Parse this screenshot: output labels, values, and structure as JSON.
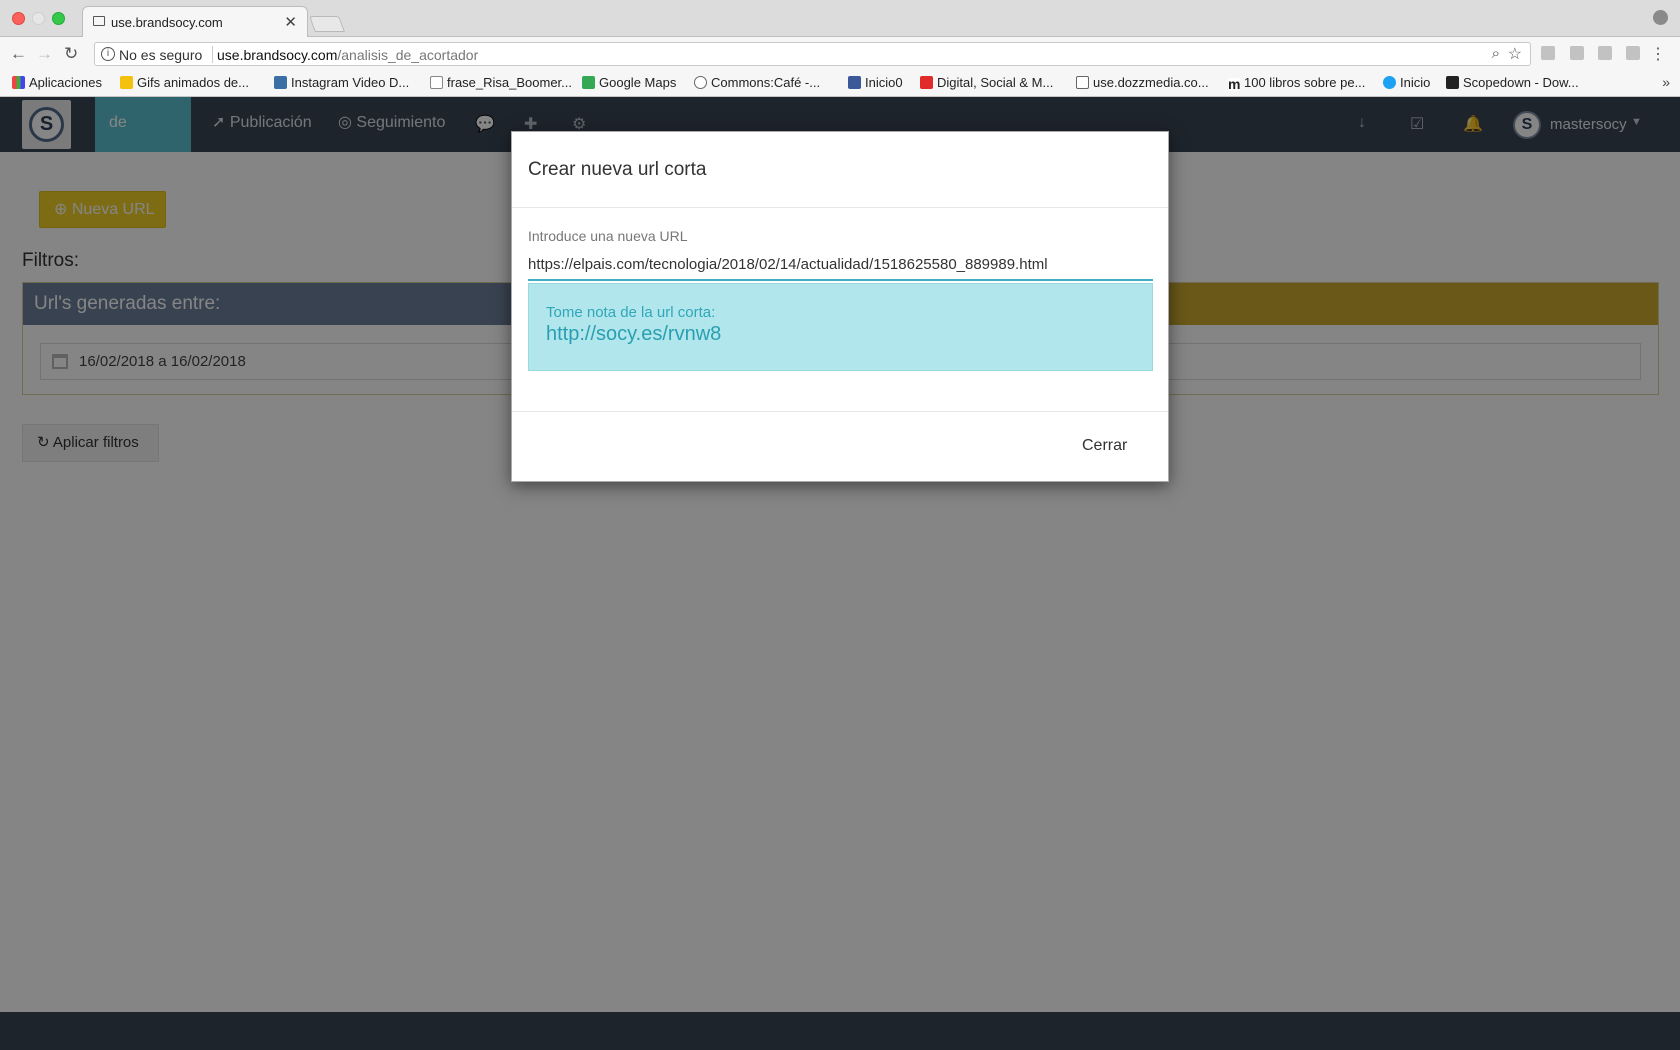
{
  "browser": {
    "tab_title": "use.brandsocy.com",
    "security_label": "No es seguro",
    "url_host": "use.brandsocy.com",
    "url_path": "/analisis_de_acortador",
    "bookmarks": [
      "Aplicaciones",
      "Gifs animados de...",
      "Instagram Video D...",
      "frase_Risa_Boomer...",
      "Google Maps",
      "Commons:Café -...",
      "Inicio0",
      "Digital, Social & M...",
      "use.dozzmedia.co...",
      "100 libros sobre pe...",
      "Inicio",
      "Scopedown - Dow..."
    ]
  },
  "app": {
    "nav": {
      "active_item": "de Tráfico",
      "items": [
        "Publicación",
        "Seguimiento"
      ],
      "user_name": "mastersocy"
    },
    "new_url_button": "Nueva URL",
    "filters_title": "Filtros:",
    "panel_title": "Url's generadas entre:",
    "date_range": "16/02/2018 a 16/02/2018",
    "apply_button": "Aplicar filtros"
  },
  "modal": {
    "title": "Crear nueva url corta",
    "field_label": "Introduce una nueva URL",
    "url_value": "https://elpais.com/tecnologia/2018/02/14/actualidad/1518625580_889989.html",
    "alert_text": "Tome nota de la url corta:",
    "short_url": "http://socy.es/rvnw8",
    "close_button": "Cerrar"
  },
  "colors": {
    "nav_bg": "#3a4555",
    "nav_active": "#5bc0cf",
    "accent_yellow": "#f1d02a",
    "alert_bg": "#b0e6ec",
    "link_teal": "#2a9fb2"
  }
}
